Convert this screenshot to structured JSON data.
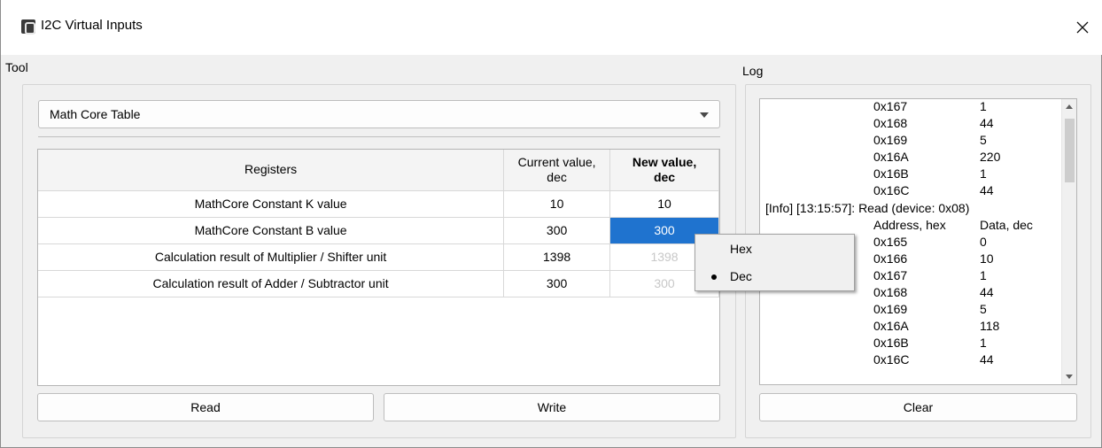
{
  "window": {
    "title": "I2C Virtual Inputs"
  },
  "tool": {
    "group_label": "Tool",
    "dropdown_value": "Math Core Table",
    "table": {
      "headers": [
        "Registers",
        "Current value,\ndec",
        "New value,\ndec"
      ],
      "rows": [
        {
          "register": "MathCore Constant K value",
          "current": "10",
          "new": "10"
        },
        {
          "register": "MathCore Constant B value",
          "current": "300",
          "new": "300"
        },
        {
          "register": "Calculation result of Multiplier / Shifter unit",
          "current": "1398",
          "new": "1398"
        },
        {
          "register": "Calculation result of Adder / Subtractor unit",
          "current": "300",
          "new": "300"
        }
      ]
    },
    "read_label": "Read",
    "write_label": "Write"
  },
  "context_menu": {
    "items": [
      {
        "label": "Hex",
        "checked": false
      },
      {
        "label": "Dec",
        "checked": true
      }
    ]
  },
  "log": {
    "group_label": "Log",
    "lines": [
      {
        "addr": "0x167",
        "val": "1"
      },
      {
        "addr": "0x168",
        "val": "44"
      },
      {
        "addr": "0x169",
        "val": "5"
      },
      {
        "addr": "0x16A",
        "val": "220"
      },
      {
        "addr": "0x16B",
        "val": "1"
      },
      {
        "addr": "0x16C",
        "val": "44"
      },
      {
        "text": "[Info] [13:15:57]: Read (device: 0x08)"
      },
      {
        "addr": "Address, hex",
        "val": "Data, dec"
      },
      {
        "addr": "0x165",
        "val": "0"
      },
      {
        "addr": "0x166",
        "val": "10"
      },
      {
        "addr": "0x167",
        "val": "1"
      },
      {
        "addr": "0x168",
        "val": "44"
      },
      {
        "addr": "0x169",
        "val": "5"
      },
      {
        "addr": "0x16A",
        "val": "118"
      },
      {
        "addr": "0x16B",
        "val": "1"
      },
      {
        "addr": "0x16C",
        "val": "44"
      }
    ],
    "clear_label": "Clear"
  },
  "colors": {
    "selection": "#1f73cf",
    "disabled_text": "#c8c8c8",
    "window_bg": "#f0f0f0"
  }
}
